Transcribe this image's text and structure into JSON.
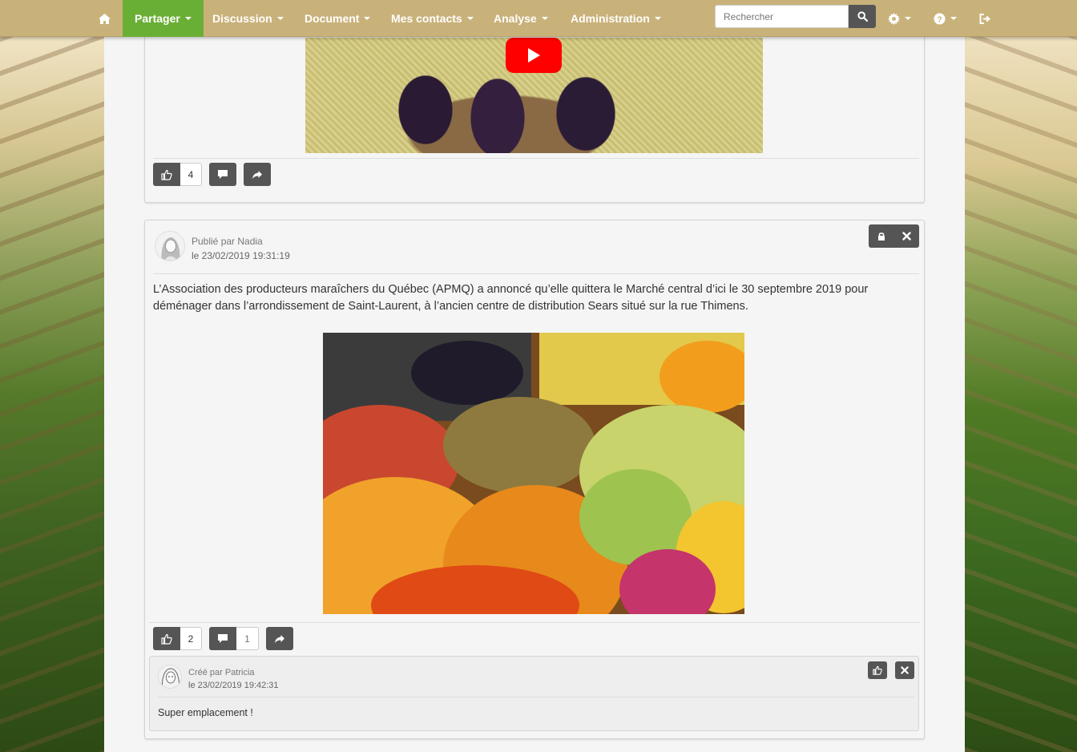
{
  "navbar": {
    "home_icon": "home-icon",
    "items": [
      {
        "label": "Partager",
        "active": true
      },
      {
        "label": "Discussion"
      },
      {
        "label": "Document"
      },
      {
        "label": "Mes contacts"
      },
      {
        "label": "Analyse"
      },
      {
        "label": "Administration"
      }
    ],
    "search_placeholder": "Rechercher",
    "search_icon": "search-icon",
    "settings_icon": "gear-icon",
    "help_icon": "help-icon",
    "logout_icon": "logout-icon",
    "colors": {
      "bar": "#c9b27a",
      "active": "#6aaf35"
    }
  },
  "post1": {
    "media": "youtube-video",
    "likes": "4"
  },
  "post2": {
    "author_line": "Publié par Nadia",
    "date_line": "le 23/02/2019 19:31:19",
    "text": "L’Association des producteurs maraîchers du Québec (APMQ) a annoncé qu’elle quittera le Marché central d’ici le 30 septembre 2019 pour déménager dans l’arrondissement de Saint-Laurent, à l’ancien centre de distribution Sears situé sur la rue Thimens.",
    "image": "fruit-market-photo",
    "likes": "2",
    "comments": "1",
    "comment": {
      "author_line": "Créé par Patricia",
      "date_line": "le 23/02/2019 19:42:31",
      "text": "Super emplacement !"
    }
  }
}
